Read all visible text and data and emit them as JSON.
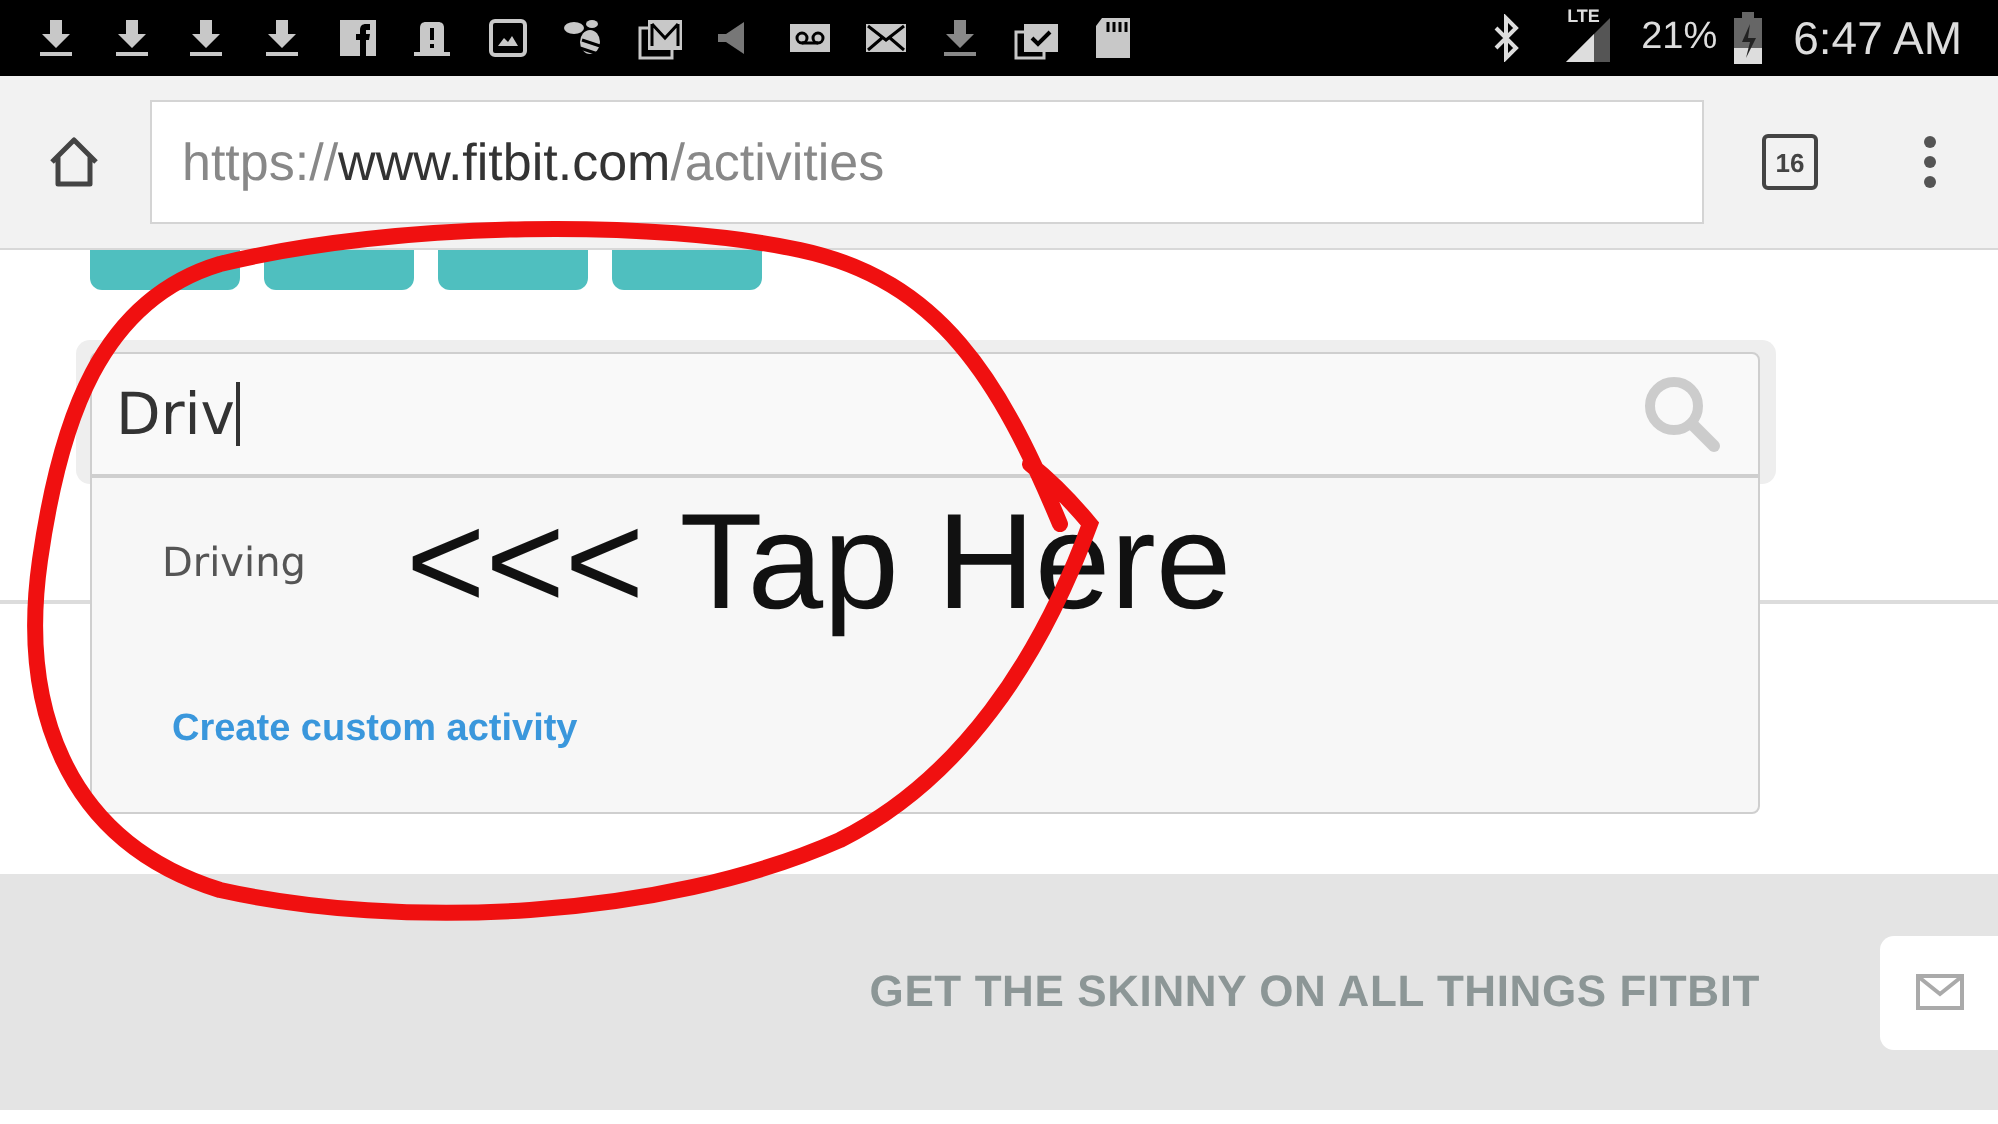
{
  "status_bar": {
    "network": "LTE",
    "battery": "21%",
    "time": "6:47 AM"
  },
  "browser": {
    "url": {
      "scheme": "https://",
      "host": "www.fitbit.com",
      "path": "/activities"
    },
    "tab_count": "16"
  },
  "search": {
    "value": "Driv",
    "suggestions": [
      {
        "label": "Driving",
        "kind": "result"
      },
      {
        "label": "Create custom activity",
        "kind": "action"
      }
    ]
  },
  "annotation": {
    "text": "<<< Tap Here"
  },
  "footer": {
    "banner": "GET THE SKINNY ON ALL THINGS FITBIT"
  }
}
